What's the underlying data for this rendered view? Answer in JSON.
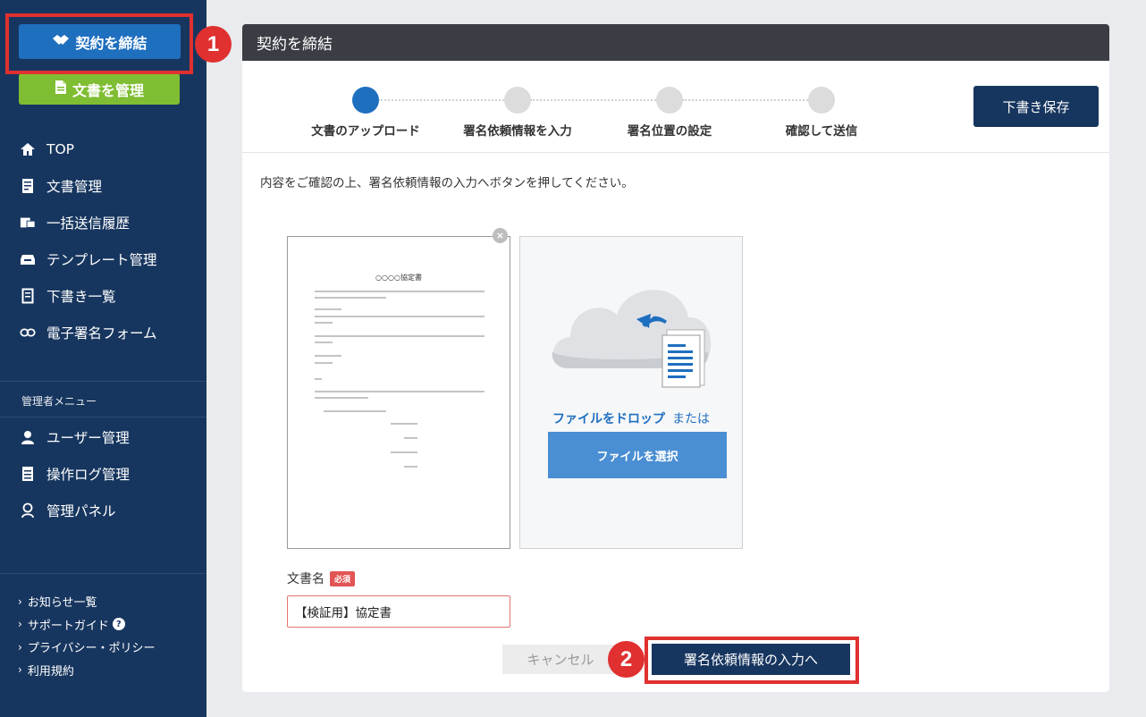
{
  "sidebar": {
    "contract_button": "契約を締結",
    "docs_button": "文書を管理",
    "nav": [
      {
        "label": "TOP",
        "icon": "home-icon"
      },
      {
        "label": "文書管理",
        "icon": "document-icon"
      },
      {
        "label": "一括送信履歴",
        "icon": "bulk-send-icon"
      },
      {
        "label": "テンプレート管理",
        "icon": "template-icon"
      },
      {
        "label": "下書き一覧",
        "icon": "draft-icon"
      },
      {
        "label": "電子署名フォーム",
        "icon": "link-icon"
      }
    ],
    "admin_label": "管理者メニュー",
    "admin_nav": [
      {
        "label": "ユーザー管理",
        "icon": "user-icon"
      },
      {
        "label": "操作ログ管理",
        "icon": "log-icon"
      },
      {
        "label": "管理パネル",
        "icon": "admin-icon"
      }
    ],
    "links": [
      {
        "label": "お知らせ一覧"
      },
      {
        "label": "サポートガイド",
        "help": "?"
      },
      {
        "label": "プライバシー・ポリシー"
      },
      {
        "label": "利用規約"
      }
    ]
  },
  "callouts": {
    "one": "1",
    "two": "2"
  },
  "panel": {
    "title": "契約を締結",
    "steps": [
      "文書のアップロード",
      "署名依頼情報を入力",
      "署名位置の設定",
      "確認して送信"
    ],
    "active_step": 0,
    "draft_button": "下書き保存",
    "instruction": "内容をご確認の上、署名依頼情報の入力へボタンを押してください。",
    "preview": {
      "doc_title": "○○○○協定書",
      "close": "×"
    },
    "dropzone": {
      "drop_text": "ファイルをドロップ",
      "or_text": "または",
      "select_button": "ファイルを選択"
    },
    "doc_name": {
      "label": "文書名",
      "required": "必須",
      "value": "【検証用】協定書"
    },
    "cancel_button": "キャンセル",
    "next_button": "署名依頼情報の入力へ"
  },
  "colors": {
    "sidebar_bg": "#17365f",
    "accent": "#1f6fbf",
    "green": "#7fbd32",
    "highlight": "#e03030"
  }
}
